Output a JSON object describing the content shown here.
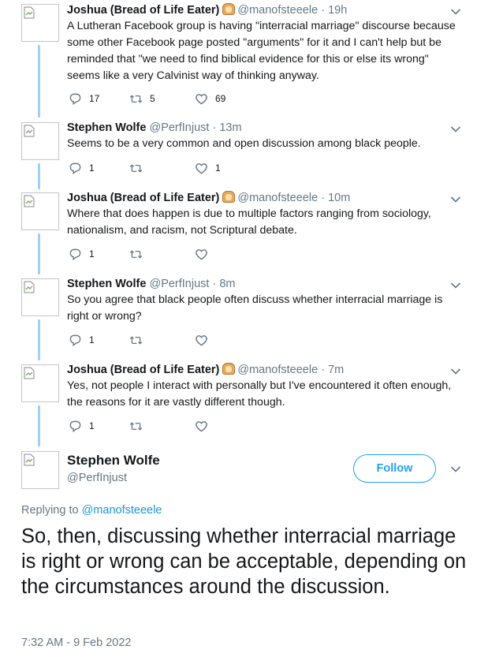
{
  "tweets": [
    {
      "name": "Joshua (Bread of Life Eater)",
      "has_emoji": true,
      "handle": "@manofsteeele",
      "dot": "·",
      "time": "19h",
      "text": "A Lutheran Facebook group is having \"interracial marriage\" discourse because some other Facebook page posted \"arguments\" for it and I can't help but be reminded that \"we need to find biblical evidence for this or else its wrong\" seems like a very Calvinist way of thinking anyway.",
      "replies": "17",
      "retweets": "5",
      "likes": "69"
    },
    {
      "name": "Stephen Wolfe",
      "has_emoji": false,
      "handle": "@PerfInjust",
      "dot": "·",
      "time": "13m",
      "text": "Seems to be a very common and open discussion among black people.",
      "replies": "1",
      "retweets": "",
      "likes": "1"
    },
    {
      "name": "Joshua (Bread of Life Eater)",
      "has_emoji": true,
      "handle": "@manofsteeele",
      "dot": "·",
      "time": "10m",
      "text": "Where that does happen is due to multiple factors ranging from sociology, nationalism, and racism, not Scriptural debate.",
      "replies": "1",
      "retweets": "",
      "likes": ""
    },
    {
      "name": "Stephen Wolfe",
      "has_emoji": false,
      "handle": "@PerfInjust",
      "dot": "·",
      "time": "8m",
      "text": "So you agree that black people often discuss whether interracial marriage is right or wrong?",
      "replies": "1",
      "retweets": "",
      "likes": ""
    },
    {
      "name": "Joshua (Bread of Life Eater)",
      "has_emoji": true,
      "handle": "@manofsteeele",
      "dot": "·",
      "time": "7m",
      "text": "Yes, not people I interact with personally but I've encountered it often enough, the reasons for it are vastly different though.",
      "replies": "1",
      "retweets": "",
      "likes": ""
    }
  ],
  "main": {
    "name": "Stephen Wolfe",
    "handle": "@PerfInjust",
    "follow_label": "Follow",
    "replying_prefix": "Replying to",
    "replying_handle": "@manofsteeele",
    "text": "So, then, discussing whether interracial marriage is right or wrong can be acceptable, depending on the circumstances around the discussion.",
    "timestamp": "7:32 AM - 9 Feb 2022"
  },
  "icons": {
    "reply": "reply-icon",
    "retweet": "retweet-icon",
    "like": "heart-icon",
    "menu": "chevron-down-icon",
    "avatar": "broken-image-icon"
  },
  "colors": {
    "accent": "#1da1f2",
    "link": "#1b95e0",
    "muted": "#657786",
    "thread_line": "#9fd2f2"
  }
}
